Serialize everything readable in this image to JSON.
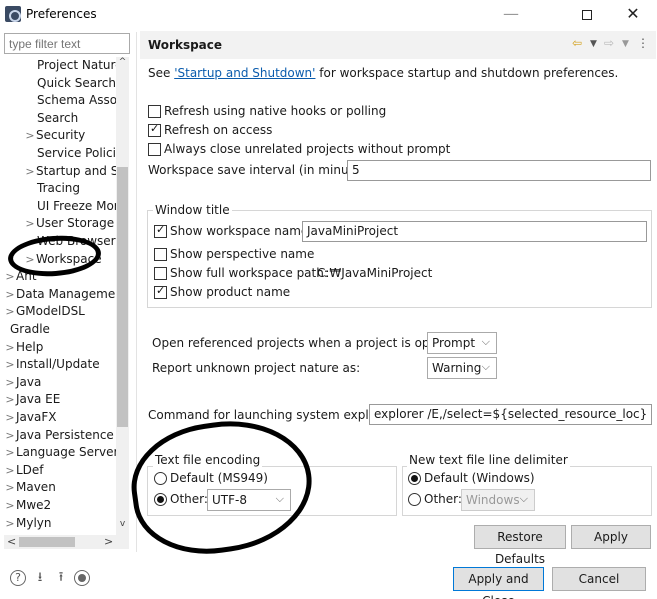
{
  "window": {
    "title": "Preferences",
    "minimize_glyph": "—",
    "close_glyph": "✕"
  },
  "sidebar": {
    "filter_placeholder": "type filter text",
    "items": [
      {
        "label": "Project Nature:",
        "indent": 2,
        "chevron": ""
      },
      {
        "label": "Quick Search",
        "indent": 2,
        "chevron": ""
      },
      {
        "label": "Schema Associ",
        "indent": 2,
        "chevron": ""
      },
      {
        "label": "Search",
        "indent": 2,
        "chevron": ""
      },
      {
        "label": "Security",
        "indent": 1,
        "chevron": ">"
      },
      {
        "label": "Service Policies",
        "indent": 2,
        "chevron": ""
      },
      {
        "label": "Startup and Sh",
        "indent": 1,
        "chevron": ">"
      },
      {
        "label": "Tracing",
        "indent": 2,
        "chevron": ""
      },
      {
        "label": "UI Freeze Mon",
        "indent": 2,
        "chevron": ""
      },
      {
        "label": "User Storage S",
        "indent": 1,
        "chevron": ">"
      },
      {
        "label": "Web Browser",
        "indent": 2,
        "chevron": ""
      },
      {
        "label": "Workspace",
        "indent": 1,
        "chevron": ">"
      },
      {
        "label": "Ant",
        "indent": 0,
        "chevron": ">"
      },
      {
        "label": "Data Managemer",
        "indent": 0,
        "chevron": ">"
      },
      {
        "label": "GModelDSL",
        "indent": 0,
        "chevron": ">"
      },
      {
        "label": "Gradle",
        "indent": 0,
        "chevron": ""
      },
      {
        "label": "Help",
        "indent": 0,
        "chevron": ">"
      },
      {
        "label": "Install/Update",
        "indent": 0,
        "chevron": ">"
      },
      {
        "label": "Java",
        "indent": 0,
        "chevron": ">"
      },
      {
        "label": "Java EE",
        "indent": 0,
        "chevron": ">"
      },
      {
        "label": "JavaFX",
        "indent": 0,
        "chevron": ">"
      },
      {
        "label": "Java Persistence",
        "indent": 0,
        "chevron": ">"
      },
      {
        "label": "Language Servers",
        "indent": 0,
        "chevron": ">"
      },
      {
        "label": "LDef",
        "indent": 0,
        "chevron": ">"
      },
      {
        "label": "Maven",
        "indent": 0,
        "chevron": ">"
      },
      {
        "label": "Mwe2",
        "indent": 0,
        "chevron": ">"
      },
      {
        "label": "Mylyn",
        "indent": 0,
        "chevron": ">"
      }
    ],
    "selected": "Workspace"
  },
  "page": {
    "title": "Workspace",
    "intro_prefix": "See ",
    "intro_link": "'Startup and Shutdown'",
    "intro_suffix": " for workspace startup and shutdown preferences.",
    "refresh_native": {
      "label": "Refresh using native hooks or polling",
      "checked": false
    },
    "refresh_access": {
      "label": "Refresh on access",
      "checked": true
    },
    "close_unrelated": {
      "label": "Always close unrelated projects without prompt",
      "checked": false
    },
    "save_interval_label": "Workspace save interval (in minutes):",
    "save_interval_value": "5",
    "window_title": {
      "legend": "Window title",
      "show_workspace_name": {
        "label": "Show workspace name:",
        "checked": true,
        "value": "JavaMiniProject"
      },
      "show_perspective": {
        "label": "Show perspective name",
        "checked": false
      },
      "show_full_path": {
        "label": "Show full workspace path:",
        "checked": false,
        "value": "C:₩JavaMiniProject"
      },
      "show_product": {
        "label": "Show product name",
        "checked": true
      }
    },
    "open_referenced_label": "Open referenced projects when a project is opened:",
    "open_referenced_value": "Prompt",
    "unknown_nature_label": "Report unknown project nature as:",
    "unknown_nature_value": "Warning",
    "explorer_label": "Command for launching system explorer:",
    "explorer_value": "explorer /E,/select=${selected_resource_loc}",
    "encoding": {
      "legend": "Text file encoding",
      "default_label": "Default (MS949)",
      "other_label": "Other:",
      "other_value": "UTF-8",
      "selected": "other"
    },
    "delimiter": {
      "legend": "New text file line delimiter",
      "default_label": "Default (Windows)",
      "other_label": "Other:",
      "other_value": "Windows",
      "selected": "default"
    },
    "restore_defaults": "Restore Defaults",
    "apply": "Apply"
  },
  "footer": {
    "apply_and_close": "Apply and Close",
    "cancel": "Cancel",
    "icons": [
      "help-icon",
      "import-icon",
      "export-icon",
      "record-icon"
    ]
  },
  "colors": {
    "link": "#0b5cad",
    "header_bg": "#f2f2f2",
    "nav_arrow": "#d4a21e",
    "ink_annotation": "#000000"
  }
}
